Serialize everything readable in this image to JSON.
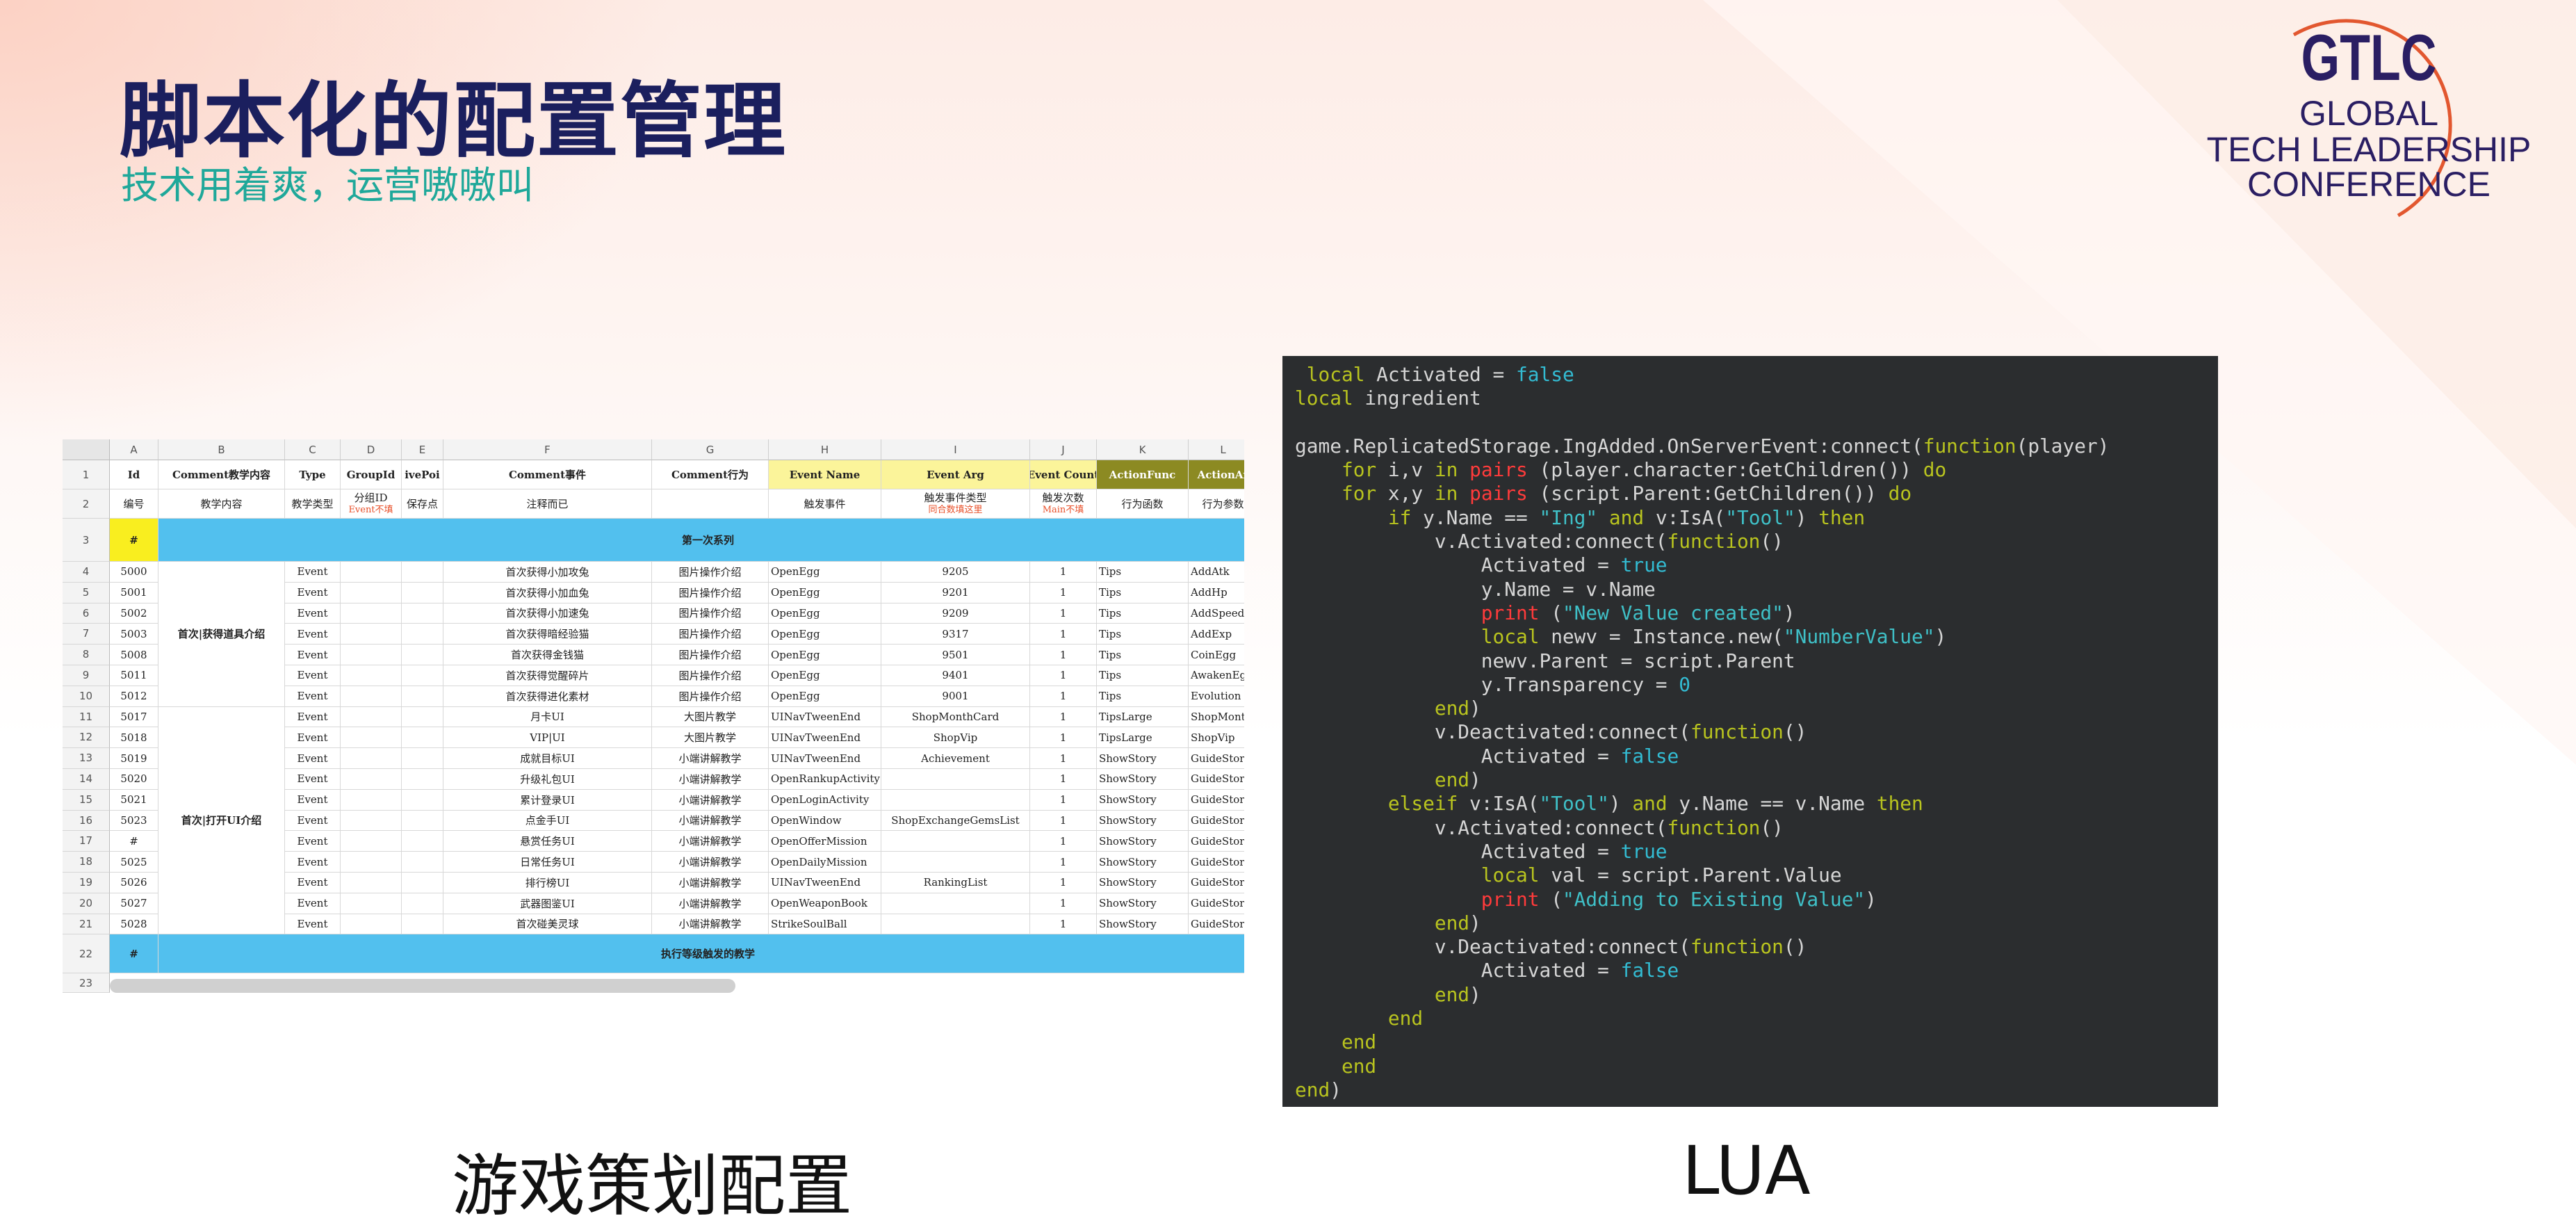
{
  "slide": {
    "title": "脚本化的配置管理",
    "subtitle": "技术用着爽，运营嗷嗷叫",
    "caption_left": "游戏策划配置",
    "caption_right": "LUA"
  },
  "logo": {
    "line1": "GTLC",
    "line2": "GLOBAL",
    "line3": "TECH LEADERSHIP",
    "line4": "CONFERENCE",
    "color": "#2a1e63",
    "arc_color": "#e2572f"
  },
  "spreadsheet": {
    "columns": [
      "A",
      "B",
      "C",
      "D",
      "E",
      "F",
      "G",
      "H",
      "I",
      "J",
      "K",
      "L"
    ],
    "header_row1": [
      "Id",
      "Comment教学内容",
      "Type",
      "GroupId",
      "ivePoi",
      "Comment事件",
      "Comment行为",
      "Event Name",
      "Event Arg",
      "Event Count",
      "ActionFunc",
      "ActionAr"
    ],
    "header_row2": [
      "编号",
      "教学内容",
      "教学类型",
      "分组ID",
      "保存点",
      "注释而已",
      "",
      "触发事件",
      "触发事件类型",
      "触发次数",
      "行为函数",
      "行为参数"
    ],
    "header_row2_notes": {
      "D": "Event不填",
      "I": "同合数填这里",
      "J": "Main不填"
    },
    "section1": {
      "hash": "#",
      "label": "第一次系列"
    },
    "group1_label": "首次|获得道具介绍",
    "group2_label": "首次|打开UI介绍",
    "rows": [
      {
        "n": "4",
        "id": "5000",
        "type": "Event",
        "desc": "首次获得小加攻兔",
        "behavior": "图片操作介绍",
        "event": "OpenEgg",
        "arg": "9205",
        "count": "1",
        "func": "Tips",
        "param": "AddAtk"
      },
      {
        "n": "5",
        "id": "5001",
        "type": "Event",
        "desc": "首次获得小加血兔",
        "behavior": "图片操作介绍",
        "event": "OpenEgg",
        "arg": "9201",
        "count": "1",
        "func": "Tips",
        "param": "AddHp"
      },
      {
        "n": "6",
        "id": "5002",
        "type": "Event",
        "desc": "首次获得小加速兔",
        "behavior": "图片操作介绍",
        "event": "OpenEgg",
        "arg": "9209",
        "count": "1",
        "func": "Tips",
        "param": "AddSpeed"
      },
      {
        "n": "7",
        "id": "5003",
        "type": "Event",
        "desc": "首次获得暗经验猫",
        "behavior": "图片操作介绍",
        "event": "OpenEgg",
        "arg": "9317",
        "count": "1",
        "func": "Tips",
        "param": "AddExp"
      },
      {
        "n": "8",
        "id": "5008",
        "type": "Event",
        "desc": "首次获得金钱猫",
        "behavior": "图片操作介绍",
        "event": "OpenEgg",
        "arg": "9501",
        "count": "1",
        "func": "Tips",
        "param": "CoinEgg"
      },
      {
        "n": "9",
        "id": "5011",
        "type": "Event",
        "desc": "首次获得觉醒碎片",
        "behavior": "图片操作介绍",
        "event": "OpenEgg",
        "arg": "9401",
        "count": "1",
        "func": "Tips",
        "param": "AwakenEgg"
      },
      {
        "n": "10",
        "id": "5012",
        "type": "Event",
        "desc": "首次获得进化素材",
        "behavior": "图片操作介绍",
        "event": "OpenEgg",
        "arg": "9001",
        "count": "1",
        "func": "Tips",
        "param": "Evolution"
      },
      {
        "n": "11",
        "id": "5017",
        "type": "Event",
        "desc": "月卡UI",
        "behavior": "大图片教学",
        "event": "UINavTweenEnd",
        "arg": "ShopMonthCard",
        "count": "1",
        "func": "TipsLarge",
        "param": "ShopMonth"
      },
      {
        "n": "12",
        "id": "5018",
        "type": "Event",
        "desc": "VIP|UI",
        "behavior": "大图片教学",
        "event": "UINavTweenEnd",
        "arg": "ShopVip",
        "count": "1",
        "func": "TipsLarge",
        "param": "ShopVip"
      },
      {
        "n": "13",
        "id": "5019",
        "type": "Event",
        "desc": "成就目标UI",
        "behavior": "小端讲解教学",
        "event": "UINavTweenEnd",
        "arg": "Achievement",
        "count": "1",
        "func": "ShowStory",
        "param": "GuideStor"
      },
      {
        "n": "14",
        "id": "5020",
        "type": "Event",
        "desc": "升级礼包UI",
        "behavior": "小端讲解教学",
        "event": "OpenRankupActivity",
        "arg": "",
        "count": "1",
        "func": "ShowStory",
        "param": "GuideStor"
      },
      {
        "n": "15",
        "id": "5021",
        "type": "Event",
        "desc": "累计登录UI",
        "behavior": "小端讲解教学",
        "event": "OpenLoginActivity",
        "arg": "",
        "count": "1",
        "func": "ShowStory",
        "param": "GuideStor"
      },
      {
        "n": "16",
        "id": "5023",
        "type": "Event",
        "desc": "点金手UI",
        "behavior": "小端讲解教学",
        "event": "OpenWindow",
        "arg": "ShopExchangeGemsList",
        "count": "1",
        "func": "ShowStory",
        "param": "GuideStor"
      },
      {
        "n": "17",
        "id": "#",
        "type": "Event",
        "desc": "悬赏任务UI",
        "behavior": "小端讲解教学",
        "event": "OpenOfferMission",
        "arg": "",
        "count": "1",
        "func": "ShowStory",
        "param": "GuideStor"
      },
      {
        "n": "18",
        "id": "5025",
        "type": "Event",
        "desc": "日常任务UI",
        "behavior": "小端讲解教学",
        "event": "OpenDailyMission",
        "arg": "",
        "count": "1",
        "func": "ShowStory",
        "param": "GuideStor"
      },
      {
        "n": "19",
        "id": "5026",
        "type": "Event",
        "desc": "排行榜UI",
        "behavior": "小端讲解教学",
        "event": "UINavTweenEnd",
        "arg": "RankingList",
        "count": "1",
        "func": "ShowStory",
        "param": "GuideStor"
      },
      {
        "n": "20",
        "id": "5027",
        "type": "Event",
        "desc": "武器图鉴UI",
        "behavior": "小端讲解教学",
        "event": "OpenWeaponBook",
        "arg": "",
        "count": "1",
        "func": "ShowStory",
        "param": "GuideStor"
      },
      {
        "n": "21",
        "id": "5028",
        "type": "Event",
        "desc": "首次碰美灵球",
        "behavior": "小端讲解教学",
        "event": "StrikeSoulBall",
        "arg": "",
        "count": "1",
        "func": "ShowStory",
        "param": "GuideStor"
      }
    ],
    "section2": {
      "hash": "#",
      "label": "执行等级触发的教学"
    },
    "last_row": "23"
  },
  "code_lines": [
    " local Activated = false",
    "local ingredient",
    "",
    "game.ReplicatedStorage.IngAdded.OnServerEvent:connect(function(player)",
    "    for i,v in pairs (player.character:GetChildren()) do",
    "    for x,y in pairs (script.Parent:GetChildren()) do",
    "        if y.Name == \"Ing\" and v:IsA(\"Tool\") then",
    "            v.Activated:connect(function()",
    "                Activated = true",
    "                y.Name = v.Name",
    "                print (\"New Value created\")",
    "                local newv = Instance.new(\"NumberValue\")",
    "                newv.Parent = script.Parent",
    "                y.Transparency = 0",
    "            end)",
    "            v.Deactivated:connect(function()",
    "                Activated = false",
    "            end)",
    "        elseif v:IsA(\"Tool\") and y.Name == v.Name then",
    "            v.Activated:connect(function()",
    "                Activated = true",
    "                local val = script.Parent.Value",
    "                print (\"Adding to Existing Value\")",
    "            end)",
    "            v.Deactivated:connect(function()",
    "                Activated = false",
    "            end)",
    "        end",
    "    end",
    "    end",
    "end)"
  ]
}
